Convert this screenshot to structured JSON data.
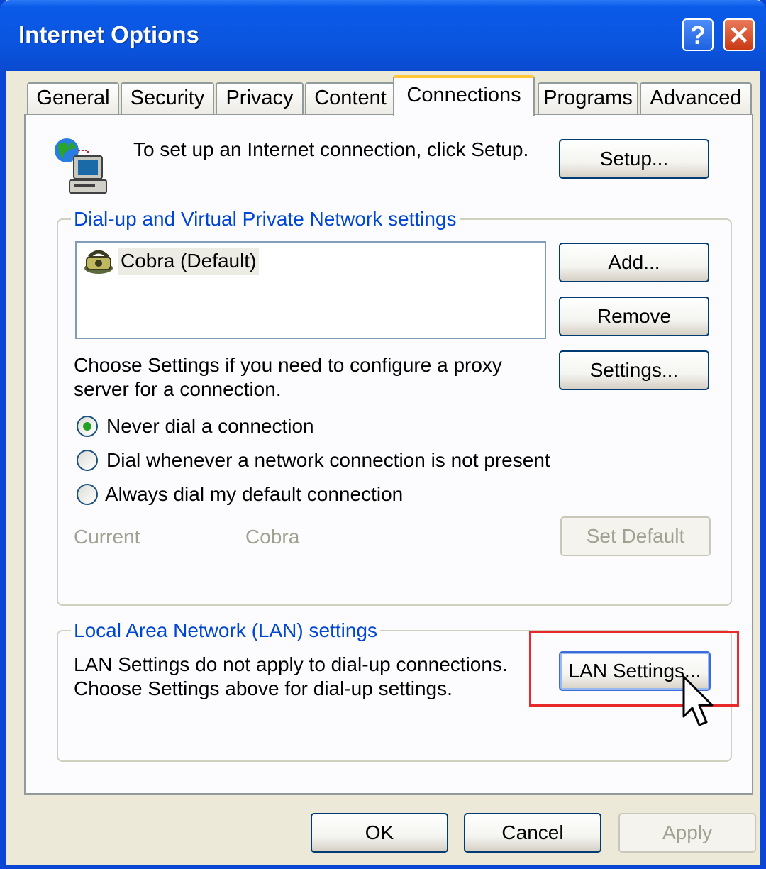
{
  "window": {
    "title": "Internet Options",
    "help_glyph": "?",
    "close_glyph": "✕"
  },
  "tabs": [
    {
      "label": "General"
    },
    {
      "label": "Security"
    },
    {
      "label": "Privacy"
    },
    {
      "label": "Content"
    },
    {
      "label": "Connections",
      "active": true
    },
    {
      "label": "Programs"
    },
    {
      "label": "Advanced"
    }
  ],
  "setup": {
    "text": "To set up an Internet connection, click Setup.",
    "button": "Setup..."
  },
  "dialup": {
    "legend": "Dial-up and Virtual Private Network settings",
    "connections": [
      {
        "label": "Cobra (Default)"
      }
    ],
    "add_button": "Add...",
    "remove_button": "Remove",
    "settings_text": "Choose Settings if you need to configure a proxy server for a connection.",
    "settings_button": "Settings...",
    "options": [
      {
        "label": "Never dial a connection",
        "selected": true
      },
      {
        "label": "Dial whenever a network connection is not present",
        "selected": false
      },
      {
        "label": "Always dial my default connection",
        "selected": false
      }
    ],
    "current_label": "Current",
    "current_value": "Cobra",
    "set_default_button": "Set Default"
  },
  "lan": {
    "legend": "Local Area Network (LAN) settings",
    "text": "LAN Settings do not apply to dial-up connections. Choose Settings above for dial-up settings.",
    "button": "LAN Settings..."
  },
  "footer": {
    "ok": "OK",
    "cancel": "Cancel",
    "apply": "Apply"
  },
  "colors": {
    "title_bar": "#0a5ae8",
    "legend_text": "#0046d5",
    "highlight_box": "#e8282b",
    "active_tab_accent": "#ffc83c"
  }
}
